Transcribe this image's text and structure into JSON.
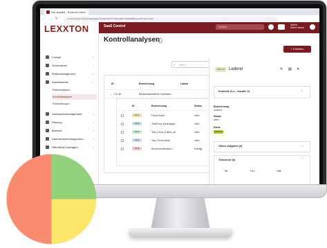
{
  "browser": {
    "tab_title": "Not applied - KontrolControl",
    "url": "control.lexxton.de/kontrollanalysen/e4a4d70a-f177-4fe4-89bc-3ab5f4a8f1ee/edit?mode=read",
    "back_icon": "arrow-left-icon",
    "forward_icon": "arrow-right-icon",
    "reload_icon": "reload-icon"
  },
  "header": {
    "logo": "LEXXTON",
    "app_name": "SaaS Control",
    "search_placeholder": "Suchen",
    "user_line1": "Admin",
    "user_line2": "Select Name"
  },
  "sidebar": {
    "items": [
      {
        "label": "Cockpit",
        "icon": "dashboard-icon"
      },
      {
        "label": "Governance",
        "icon": "governance-icon"
      },
      {
        "label": "Risikomanagement",
        "icon": "risk-icon"
      },
      {
        "label": "Assessments",
        "icon": "assessment-icon"
      }
    ],
    "subitems": [
      {
        "label": "Risikoanalysen",
        "active": false
      },
      {
        "label": "Kontrollanalysen",
        "active": true
      },
      {
        "label": "Feststellungen",
        "active": false
      }
    ],
    "items2": [
      {
        "label": "Lieferantenmanagement",
        "icon": "supplier-icon"
      },
      {
        "label": "Planung",
        "icon": "calendar-icon"
      },
      {
        "label": "Berichte",
        "icon": "report-icon"
      },
      {
        "label": "Datenschutzmanagement",
        "icon": "privacy-icon"
      },
      {
        "label": "Öffentliche Umfragen",
        "icon": "survey-icon"
      }
    ]
  },
  "main": {
    "title": "Kontrollanalysen",
    "create_label": "+ Erstellen",
    "filter_placeholder": "Filter...",
    "columns": [
      "ID",
      "Bezeichnung",
      "Labels"
    ],
    "group_row": {
      "id": "CA-36",
      "name": "Bestandsaufnahme Operation..."
    },
    "sub_columns": [
      "ID",
      "Bezeichnung",
      "Status"
    ],
    "sub_rows": [
      {
        "id": "CA-1",
        "name": "Firma Huber",
        "status": "offen",
        "color": "#e9e2a8"
      },
      {
        "id": "CA-2",
        "name": "TestFirma_Bearbeiger",
        "status": "offen",
        "color": "#bfe3e6"
      },
      {
        "id": "CA-3",
        "name": "Test_Firma_Edited_Alt",
        "status": "offen",
        "color": "#c6e8d2"
      },
      {
        "id": "CA-4",
        "name": "Test_Firma Maier",
        "status": "offen",
        "color": "#c9dff6"
      },
      {
        "id": "CA-5",
        "name": "Branchenstandard I",
        "status": "erledigt",
        "color": "#f6c9c9"
      }
    ]
  },
  "panel": {
    "badge": "CA1-10",
    "title": "Lederer",
    "card1_label": "Kontrolle 01-L - Anzahl: 13",
    "field1_label": "Bezeichnung",
    "field1_value": "Lederer",
    "field2_label": "Status",
    "field2_value": "offen",
    "field3_label": "Farbe",
    "field3_value": "#b8c724",
    "section1": "Offene Aufgaben (0)",
    "section2": "Teilnehmer (0)",
    "sub_cols": [
      "Tät...",
      "Fun...",
      "Hält..."
    ]
  },
  "pie_chart": {
    "chart_data": {
      "type": "pie",
      "values": [
        25,
        25,
        50
      ],
      "colors": [
        "#92d07c",
        "#fde76a",
        "#f98c70"
      ]
    }
  }
}
